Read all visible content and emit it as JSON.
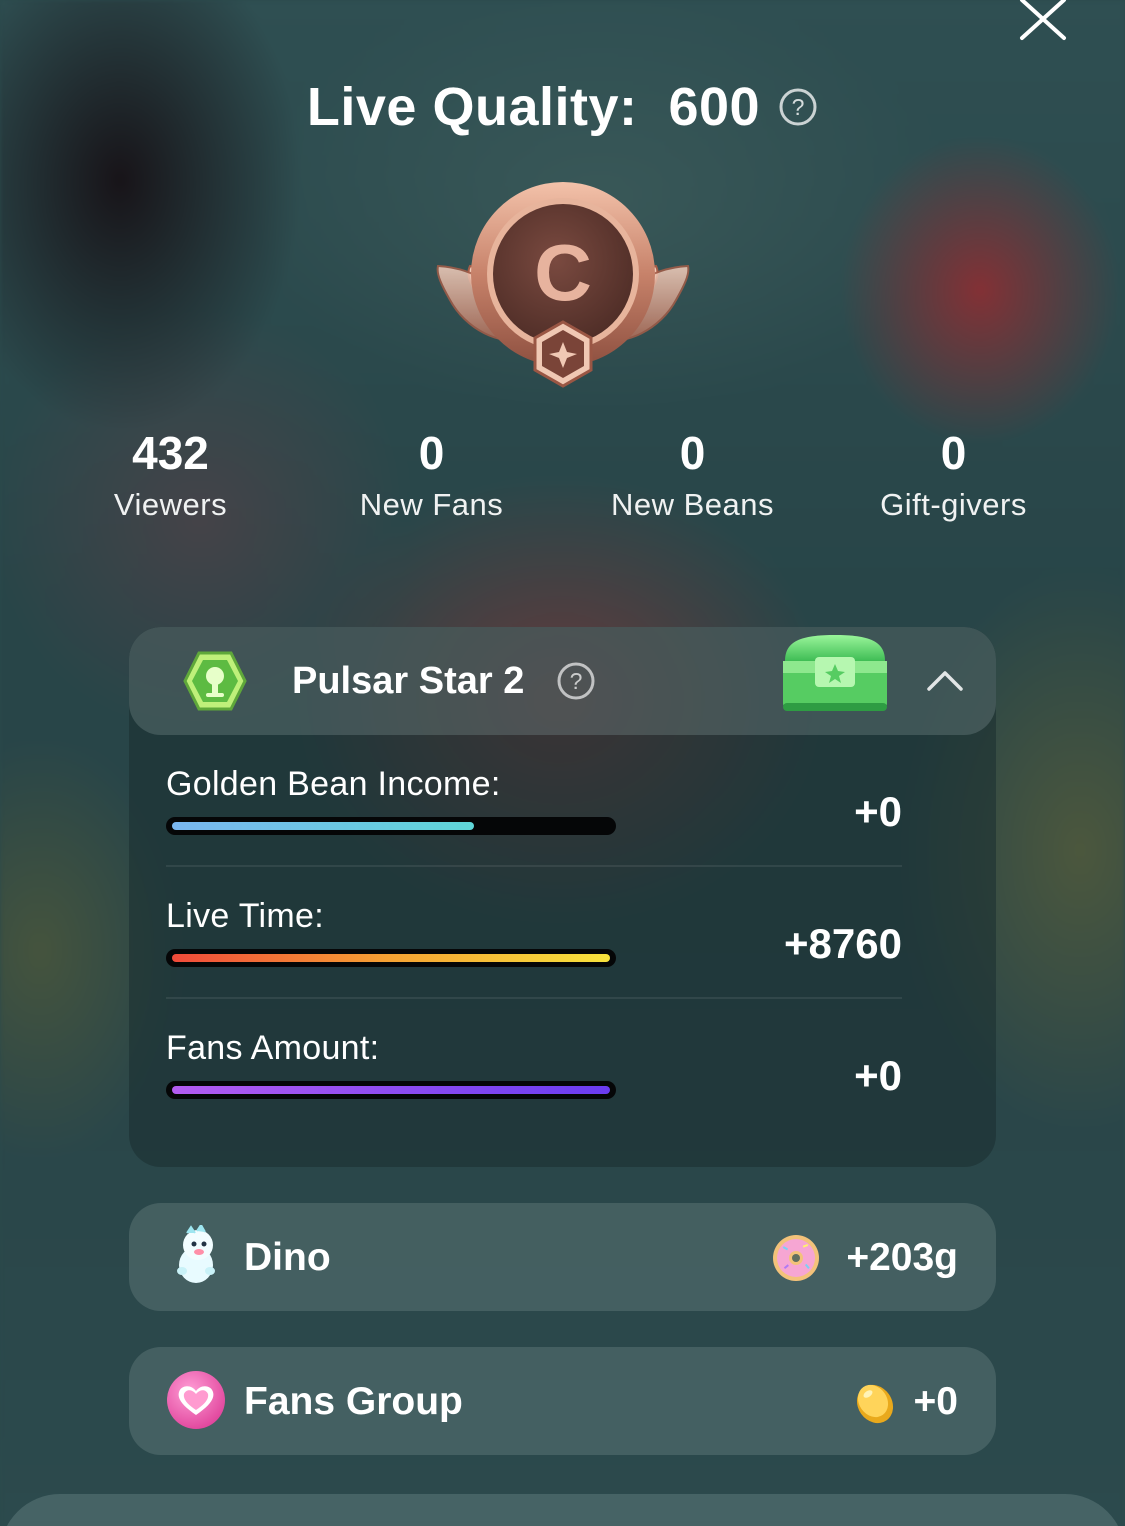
{
  "header": {
    "title": "Live Quality:  600",
    "help_icon": "question-circle-icon",
    "close_icon": "close-icon"
  },
  "badge": {
    "grade": "C",
    "icon": "bronze-winged-medal-icon"
  },
  "stats": [
    {
      "value": "432",
      "label": "Viewers"
    },
    {
      "value": "0",
      "label": "New Fans"
    },
    {
      "value": "0",
      "label": "New Beans"
    },
    {
      "value": "0",
      "label": "Gift-givers"
    }
  ],
  "level_panel": {
    "title": "Pulsar Star 2",
    "level_icon": "green-hexagon-mic-icon",
    "chest_icon": "green-treasure-chest-icon",
    "collapse_icon": "chevron-up-icon",
    "rows": [
      {
        "label": "Golden Bean Income:",
        "value": "+0",
        "progress": 0.69,
        "colors": [
          "#7ab6f0",
          "#5fd6d8"
        ]
      },
      {
        "label": "Live Time:",
        "value": "+8760",
        "progress": 1.0,
        "colors": [
          "#f04a3a",
          "#f5a233",
          "#f7e23c"
        ]
      },
      {
        "label": "Fans Amount:",
        "value": "+0",
        "progress": 1.0,
        "colors": [
          "#b35cf0",
          "#6a3cf0"
        ]
      }
    ]
  },
  "cards": [
    {
      "label": "Dino",
      "value": "+203g",
      "icon": "dino-icon",
      "coin_icon": "donut-icon"
    },
    {
      "label": "Fans Group",
      "value": "+0",
      "icon": "heart-badge-icon",
      "coin_icon": "gold-bean-icon"
    }
  ]
}
